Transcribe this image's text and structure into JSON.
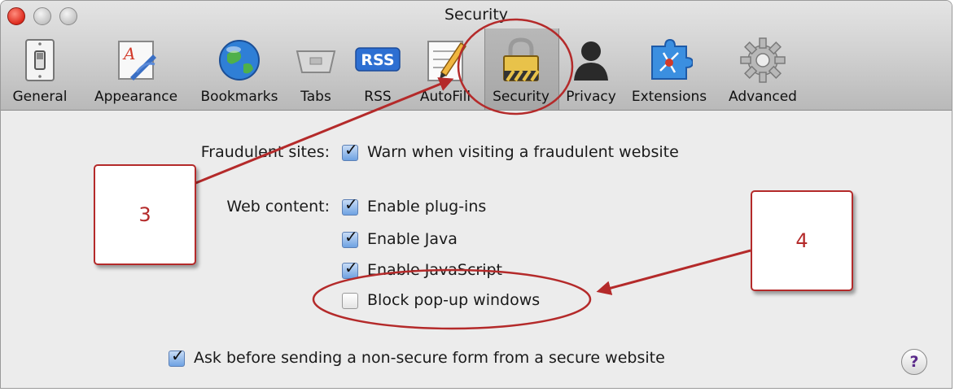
{
  "window": {
    "title": "Security"
  },
  "toolbar": {
    "items": [
      {
        "label": "General",
        "icon": "light-switch-icon"
      },
      {
        "label": "Appearance",
        "icon": "font-pen-icon"
      },
      {
        "label": "Bookmarks",
        "icon": "globe-icon"
      },
      {
        "label": "Tabs",
        "icon": "tabs-icon"
      },
      {
        "label": "RSS",
        "icon": "rss-icon"
      },
      {
        "label": "AutoFill",
        "icon": "pencil-form-icon"
      },
      {
        "label": "Security",
        "icon": "padlock-icon",
        "selected": true
      },
      {
        "label": "Privacy",
        "icon": "person-silhouette-icon"
      },
      {
        "label": "Extensions",
        "icon": "puzzle-compass-icon"
      },
      {
        "label": "Advanced",
        "icon": "gear-icon"
      }
    ],
    "rss_badge": "RSS"
  },
  "preferences": {
    "fraudulent": {
      "label": "Fraudulent sites:",
      "options": [
        {
          "text": "Warn when visiting a fraudulent website",
          "checked": true
        }
      ]
    },
    "web_content": {
      "label": "Web content:",
      "options": [
        {
          "text": "Enable plug-ins",
          "checked": true
        },
        {
          "text": "Enable Java",
          "checked": true
        },
        {
          "text": "Enable JavaScript",
          "checked": true
        },
        {
          "text": "Block pop-up windows",
          "checked": false
        }
      ]
    },
    "form_warning": {
      "text": "Ask before sending a non-secure form from a secure website",
      "checked": true
    },
    "help": "?"
  },
  "annotations": {
    "callout_3": "3",
    "callout_4": "4",
    "color": "#b42a2a"
  }
}
